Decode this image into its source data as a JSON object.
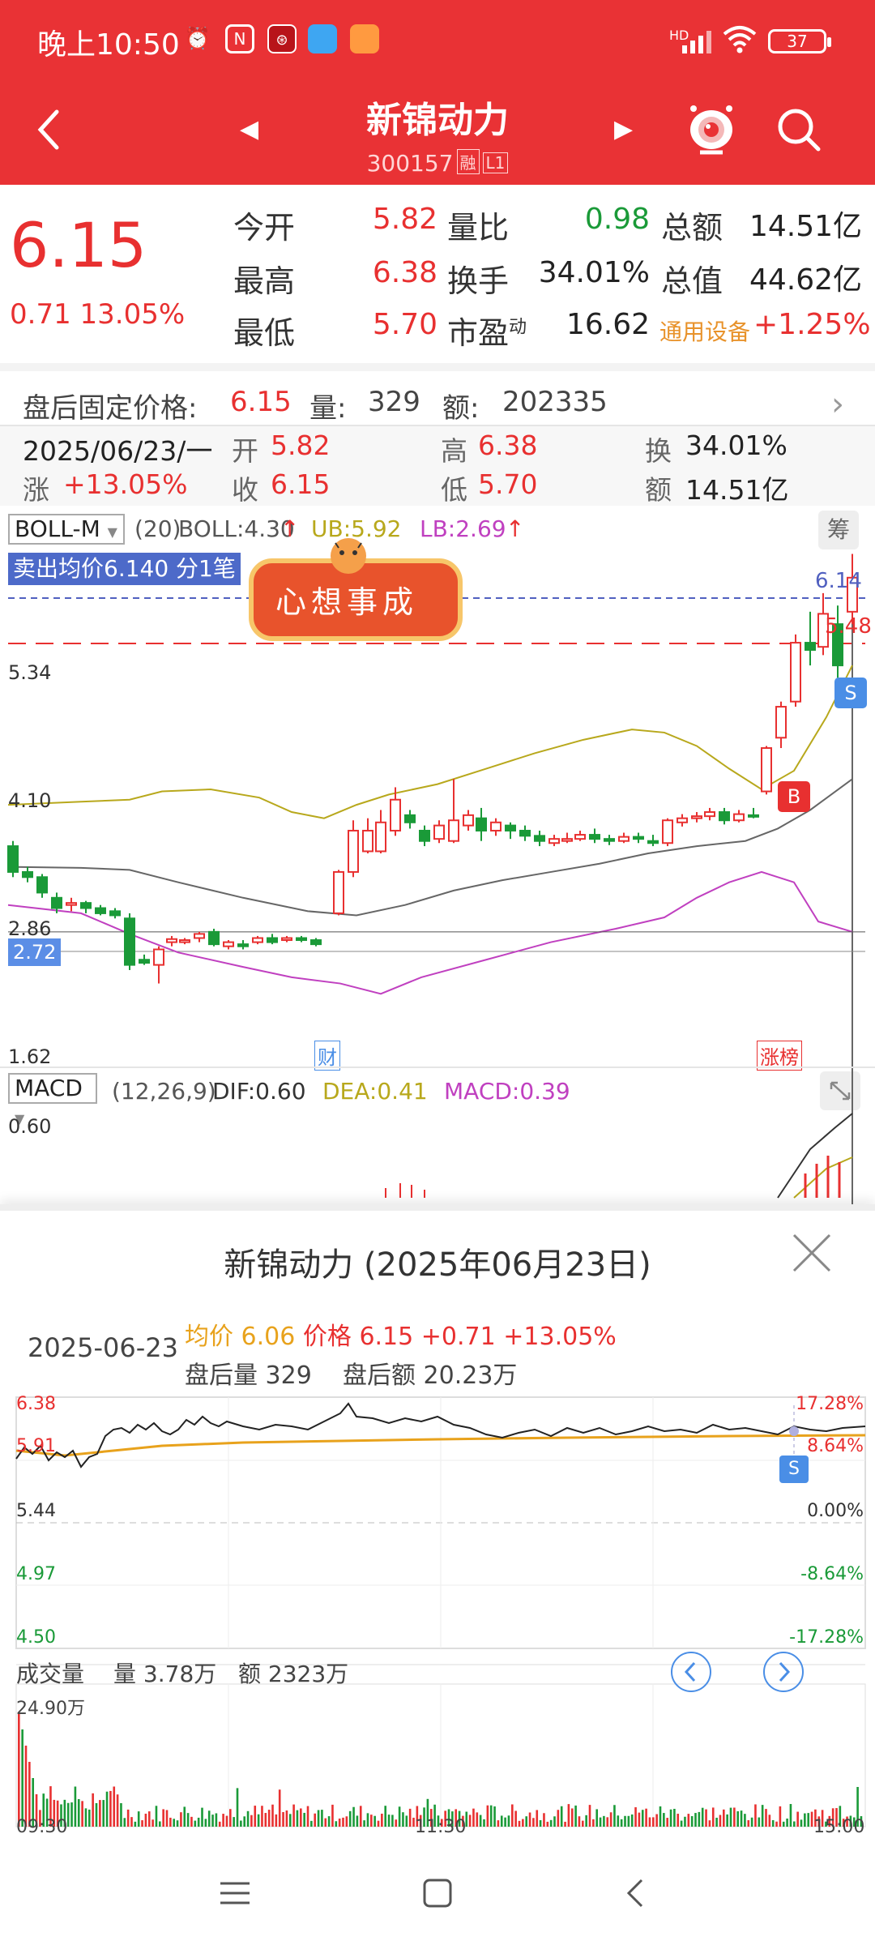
{
  "status": {
    "time": "晚上10:50",
    "network": "HD",
    "battery": "37",
    "notif_icons": [
      "alarm-icon",
      "nfc-icon",
      "app-icon-red",
      "app-icon-blue",
      "app-icon-orange"
    ]
  },
  "header": {
    "title": "新锦动力",
    "code": "300157",
    "badges": [
      "融",
      "L1"
    ]
  },
  "quote": {
    "price": "6.15",
    "change": "0.71",
    "change_pct": "13.05%",
    "rows": [
      {
        "l1": "今开",
        "v1": "5.82",
        "l2": "量比",
        "v2": "0.98",
        "l3": "总额",
        "v3": "14.51亿"
      },
      {
        "l1": "最高",
        "v1": "6.38",
        "l2": "换手",
        "v2": "34.01%",
        "l3": "总值",
        "v3": "44.62亿"
      },
      {
        "l1": "最低",
        "v1": "5.70",
        "l2": "市盈",
        "l2_sup": "动",
        "v2": "16.62",
        "l3": "通用设备",
        "v3": "+1.25%"
      }
    ]
  },
  "afterhours": {
    "label": "盘后固定价格:",
    "price": "6.15",
    "vol_label": "量:",
    "vol": "329",
    "amt_label": "额:",
    "amt": "202335"
  },
  "daybar": {
    "date": "2025/06/23/一",
    "open_l": "开",
    "open": "5.82",
    "high_l": "高",
    "high": "6.38",
    "turn_l": "换",
    "turn": "34.01%",
    "chg_l": "涨",
    "chg": "+13.05%",
    "close_l": "收",
    "close": "6.15",
    "low_l": "低",
    "low": "5.70",
    "amt_l": "额",
    "amt": "14.51亿"
  },
  "kchart": {
    "indicator": "BOLL-M",
    "params": "(20)",
    "boll": "BOLL:4.30",
    "ub": "UB:5.92",
    "lb": "LB:2.69",
    "chip_btn": "筹",
    "sell_label": "卖出均价6.140 分1笔",
    "sticker_text": "心想事成",
    "price_tag": "6.14",
    "y_labels": [
      "5.34",
      "4.10",
      "2.86",
      "1.62"
    ],
    "current_label": "2.72",
    "marker_b": "B",
    "marker_s": "S",
    "tag_cai": "财",
    "tag_zhangbang": "涨榜",
    "line_label": "5.48"
  },
  "macd": {
    "indicator": "MACD",
    "params": "(12,26,9)",
    "dif": "DIF:0.60",
    "dea": "DEA:0.41",
    "macd": "MACD:0.39",
    "y_label": "0.60"
  },
  "popup": {
    "title": "新锦动力 (2025年06月23日)",
    "date": "2025-06-23",
    "avg_label": "均价",
    "avg": "6.06",
    "price_label": "价格",
    "price": "6.15",
    "change": "+0.71",
    "change_pct": "+13.05%",
    "ah_vol_label": "盘后量",
    "ah_vol": "329",
    "ah_amt_label": "盘后额",
    "ah_amt": "20.23万",
    "y_left": [
      "6.38",
      "5.91",
      "5.44",
      "4.97",
      "4.50"
    ],
    "y_right": [
      "17.28%",
      "8.64%",
      "0.00%",
      "-8.64%",
      "-17.28%"
    ],
    "marker_s": "S",
    "vol_title": "成交量",
    "vol_label": "量",
    "vol": "3.78万",
    "amt_label": "额",
    "amt": "2323万",
    "vol_max": "24.90万",
    "x_labels": [
      "09:30",
      "11:30",
      "15:00"
    ]
  },
  "colors": {
    "header_red": "#e93235",
    "up_red": "#e83030",
    "down_green": "#1a9a38",
    "avg_orange": "#e8a21c",
    "boll_mid": "#b8a81c",
    "boll_lower": "#c040c0",
    "dashed_blue": "#5060c0"
  }
}
